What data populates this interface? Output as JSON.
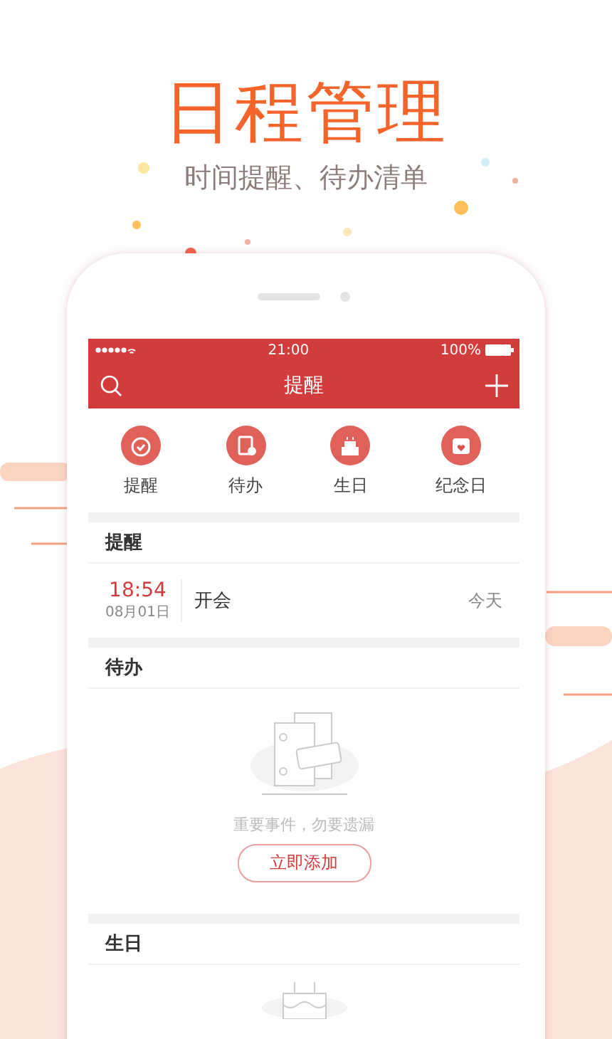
{
  "hero": {
    "title": "日程管理",
    "subtitle": "时间提醒、待办清单"
  },
  "status_bar": {
    "time": "21:00",
    "battery": "100%"
  },
  "nav": {
    "title": "提醒"
  },
  "categories": [
    {
      "label": "提醒",
      "kind": "alarm"
    },
    {
      "label": "待办",
      "kind": "todo"
    },
    {
      "label": "生日",
      "kind": "cake"
    },
    {
      "label": "纪念日",
      "kind": "calendar"
    }
  ],
  "sections": [
    {
      "title": "提醒",
      "kind": "list",
      "items": [
        {
          "time": "18:54",
          "date": "08月01日",
          "title": "开会",
          "day": "今天"
        }
      ]
    },
    {
      "title": "待办",
      "kind": "empty",
      "message": "重要事件，勿要遗漏",
      "action": "立即添加"
    },
    {
      "title": "生日",
      "kind": "cake"
    }
  ]
}
